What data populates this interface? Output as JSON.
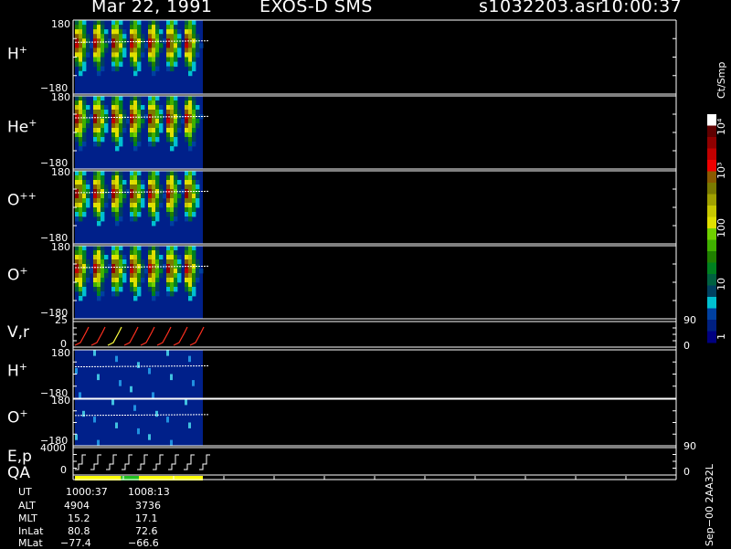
{
  "header": {
    "date": "Mar 22, 1991",
    "instrument": "EXOS-D SMS",
    "file": "s1032203.asr",
    "time": "10:00:37"
  },
  "panels": [
    {
      "id": "h",
      "label": "H",
      "sup": "+",
      "ymax": "180",
      "ymin": "−180"
    },
    {
      "id": "he",
      "label": "He",
      "sup": "+",
      "ymax": "180",
      "ymin": "−180"
    },
    {
      "id": "opp",
      "label": "O",
      "sup": "++",
      "ymax": "180",
      "ymin": "−180"
    },
    {
      "id": "o",
      "label": "O",
      "sup": "+",
      "ymax": "180",
      "ymin": "−180"
    },
    {
      "id": "vr",
      "label": "V,r",
      "sup": "",
      "ymax": "25",
      "ymin": "0",
      "right_top": "90",
      "right_bottom": "0"
    },
    {
      "id": "h2",
      "label": "H",
      "sup": "+",
      "ymax": "180",
      "ymin": "−180"
    },
    {
      "id": "o2",
      "label": "O",
      "sup": "+",
      "ymax": "180",
      "ymin": "−180"
    },
    {
      "id": "ep",
      "label": "E,p",
      "sup": "",
      "ymax": "4000",
      "ymin": "0",
      "right_top": "90",
      "right_bottom": "0"
    }
  ],
  "qa_label": "QA",
  "info_table": {
    "rows": [
      {
        "label": "UT",
        "v1": "1000:37",
        "v2": "1008:13"
      },
      {
        "label": "ALT",
        "v1": "4904",
        "v2": "3736"
      },
      {
        "label": "MLT",
        "v1": "15.2",
        "v2": "17.1"
      },
      {
        "label": "InLat",
        "v1": "80.8",
        "v2": "72.6"
      },
      {
        "label": "MLat",
        "v1": "−77.4",
        "v2": "−66.6"
      }
    ]
  },
  "colorbar": {
    "title": "Ct/Smp",
    "tick_labels": [
      "1",
      "10",
      "100",
      "10³",
      "10⁴"
    ],
    "colors": [
      "#ffffff",
      "#600000",
      "#900000",
      "#c00000",
      "#f00000",
      "#8a5a00",
      "#7a7a00",
      "#a0a000",
      "#c8c800",
      "#e0e000",
      "#70d000",
      "#40b000",
      "#208000",
      "#008020",
      "#006040",
      "#004060",
      "#00c0d0",
      "#0040a0",
      "#002080",
      "#000080"
    ]
  },
  "footer_tag": "Sep−00  2AA32L",
  "chart_data": {
    "type": "heatmap",
    "title": "Mar 22, 1991   EXOS-D SMS",
    "x_time_range": [
      "1000:37",
      "1008:13"
    ],
    "scans": 7,
    "panels": [
      {
        "name": "H+",
        "ylim": [
          -180,
          180
        ]
      },
      {
        "name": "He+",
        "ylim": [
          -180,
          180
        ]
      },
      {
        "name": "O++",
        "ylim": [
          -180,
          180
        ]
      },
      {
        "name": "O+",
        "ylim": [
          -180,
          180
        ]
      },
      {
        "name": "V,r",
        "ylim": [
          0,
          25
        ],
        "ylim_right": [
          0,
          90
        ]
      },
      {
        "name": "H+",
        "ylim": [
          -180,
          180
        ]
      },
      {
        "name": "O+",
        "ylim": [
          -180,
          180
        ]
      },
      {
        "name": "E,p",
        "ylim": [
          0,
          4000
        ],
        "ylim_right": [
          0,
          90
        ]
      }
    ],
    "colorscale": {
      "label": "Ct/Smp",
      "range": [
        1,
        10000
      ],
      "log": true
    },
    "qa_segments": [
      {
        "from": 0,
        "to": 0.36,
        "color": "#ffff00"
      },
      {
        "from": 0.36,
        "to": 0.5,
        "color": "#20c020"
      },
      {
        "from": 0.5,
        "to": 1.0,
        "color": "#ffff00"
      }
    ]
  }
}
